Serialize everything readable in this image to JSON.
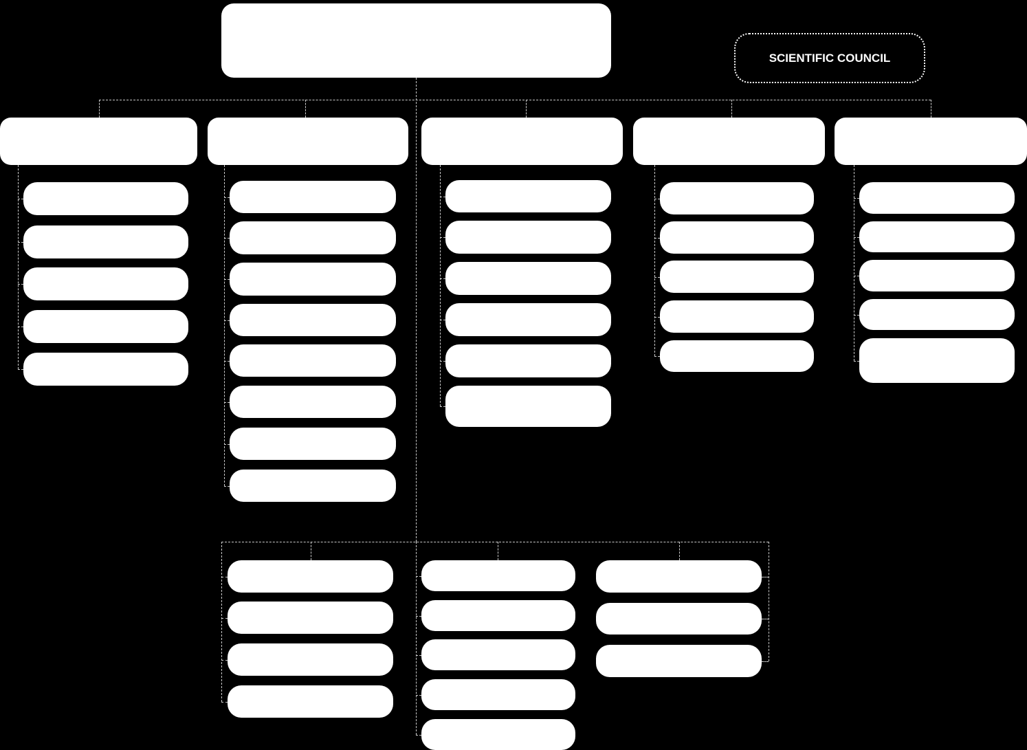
{
  "council": {
    "label": "SCIENTIFIC COUNCIL"
  },
  "colors": {
    "background": "#000000",
    "box": "#ffffff",
    "connector": "#cccccc"
  }
}
